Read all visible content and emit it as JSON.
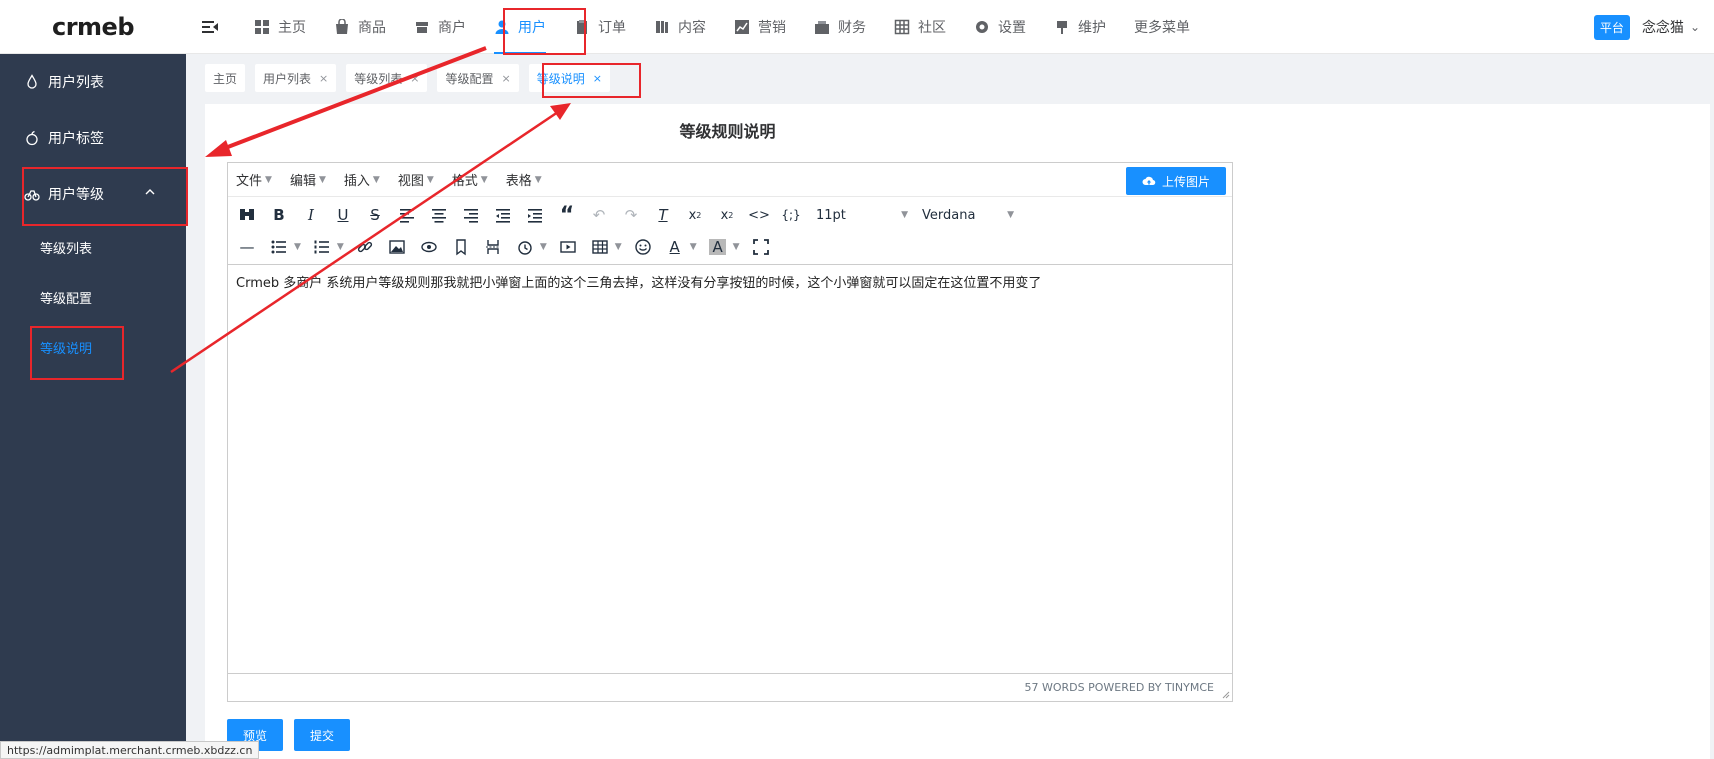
{
  "brand": {
    "logo_text": "crmeb"
  },
  "nav": {
    "items": [
      {
        "label": "主页",
        "icon": "grid-icon"
      },
      {
        "label": "商品",
        "icon": "bag-icon"
      },
      {
        "label": "商户",
        "icon": "store-icon"
      },
      {
        "label": "用户",
        "icon": "user-icon",
        "active": true
      },
      {
        "label": "订单",
        "icon": "clipboard-icon"
      },
      {
        "label": "内容",
        "icon": "book-icon"
      },
      {
        "label": "营销",
        "icon": "chart-line-icon"
      },
      {
        "label": "财务",
        "icon": "wallet-icon"
      },
      {
        "label": "社区",
        "icon": "table-icon"
      },
      {
        "label": "设置",
        "icon": "gear-icon"
      },
      {
        "label": "维护",
        "icon": "brush-icon"
      },
      {
        "label": "更多菜单",
        "icon": ""
      }
    ],
    "platform_badge": "平台",
    "username": "念念猫"
  },
  "sidebar": {
    "items": [
      {
        "label": "用户列表",
        "icon": "drop-icon"
      },
      {
        "label": "用户标签",
        "icon": "apple-icon"
      },
      {
        "label": "用户等级",
        "icon": "bike-icon",
        "expanded": true
      }
    ],
    "subitems": [
      {
        "label": "等级列表"
      },
      {
        "label": "等级配置"
      },
      {
        "label": "等级说明",
        "active": true
      }
    ]
  },
  "tabs": [
    {
      "label": "主页",
      "closable": false
    },
    {
      "label": "用户列表",
      "closable": true
    },
    {
      "label": "等级列表",
      "closable": true
    },
    {
      "label": "等级配置",
      "closable": true
    },
    {
      "label": "等级说明",
      "closable": true,
      "active": true
    }
  ],
  "page": {
    "title": "等级规则说明"
  },
  "editor": {
    "menus": [
      "文件",
      "编辑",
      "插入",
      "视图",
      "格式",
      "表格"
    ],
    "upload_label": "上传图片",
    "font_size": "11pt",
    "font_family": "Verdana",
    "content": "Crmeb 多商户 系统用户等级规则那我就把小弹窗上面的这个三角去掉，这样没有分享按钮的时候，这个小弹窗就可以固定在这位置不用变了",
    "status": "57 WORDS POWERED BY TINYMCE"
  },
  "actions": {
    "preview_label": "预览",
    "submit_label": "提交"
  },
  "browser_status_url": "https://admimplat.merchant.crmeb.xbdzz.cn",
  "colors": {
    "accent": "#1890ff",
    "sidebar_bg": "#2f3b4f",
    "annotation": "#e8262b"
  }
}
